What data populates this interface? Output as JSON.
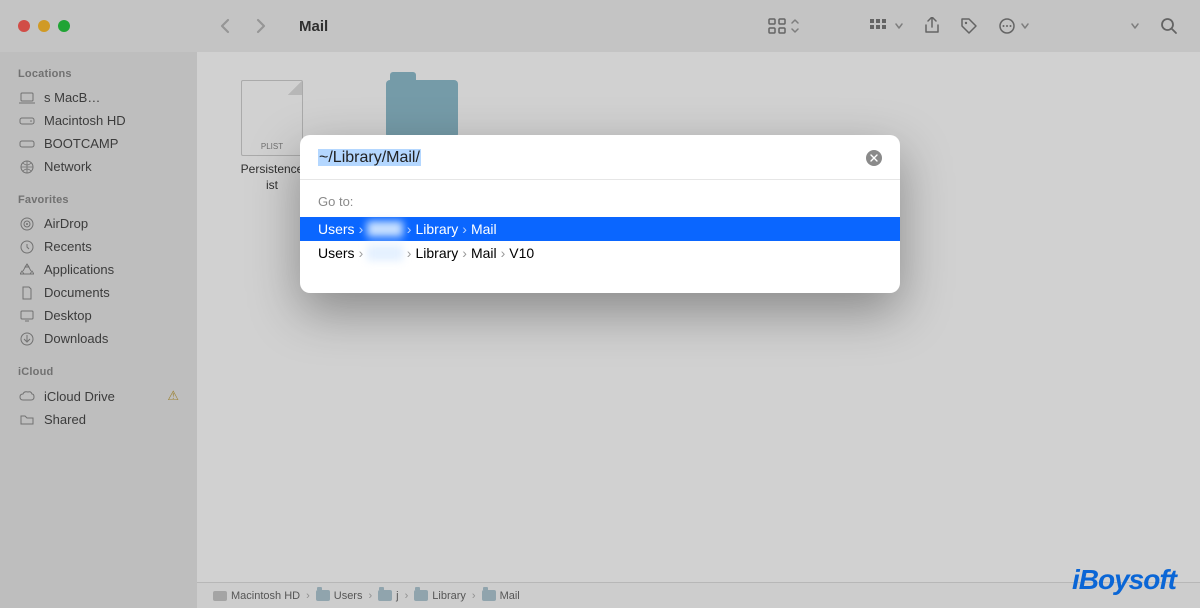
{
  "window": {
    "title": "Mail"
  },
  "sidebar": {
    "sections": [
      {
        "title": "Locations",
        "items": [
          {
            "icon": "laptop",
            "label": "s MacB…"
          },
          {
            "icon": "disk",
            "label": "Macintosh HD"
          },
          {
            "icon": "disk-o",
            "label": "BOOTCAMP"
          },
          {
            "icon": "globe",
            "label": "Network"
          }
        ]
      },
      {
        "title": "Favorites",
        "items": [
          {
            "icon": "airdrop",
            "label": "AirDrop"
          },
          {
            "icon": "clock",
            "label": "Recents"
          },
          {
            "icon": "apps",
            "label": "Applications"
          },
          {
            "icon": "doc",
            "label": "Documents"
          },
          {
            "icon": "desktop",
            "label": "Desktop"
          },
          {
            "icon": "download",
            "label": "Downloads"
          }
        ]
      },
      {
        "title": "iCloud",
        "items": [
          {
            "icon": "cloud",
            "label": "iCloud Drive",
            "warn": true
          },
          {
            "icon": "folder",
            "label": "Shared"
          }
        ]
      }
    ]
  },
  "files": [
    {
      "type": "file",
      "thumb_label": "PLIST",
      "name": "Persistence\nist"
    },
    {
      "type": "folder",
      "name": ""
    }
  ],
  "path_bar": [
    "Macintosh HD",
    "Users",
    "j",
    "Library",
    "Mail"
  ],
  "modal": {
    "input_value": "~/Library/Mail/",
    "goto_label": "Go to:",
    "results": [
      {
        "segments": [
          "Users",
          "",
          "Library",
          "Mail"
        ],
        "selected": true
      },
      {
        "segments": [
          "Users",
          "",
          "Library",
          "Mail",
          "V10"
        ],
        "selected": false
      }
    ]
  },
  "watermark": "iBoysoft"
}
